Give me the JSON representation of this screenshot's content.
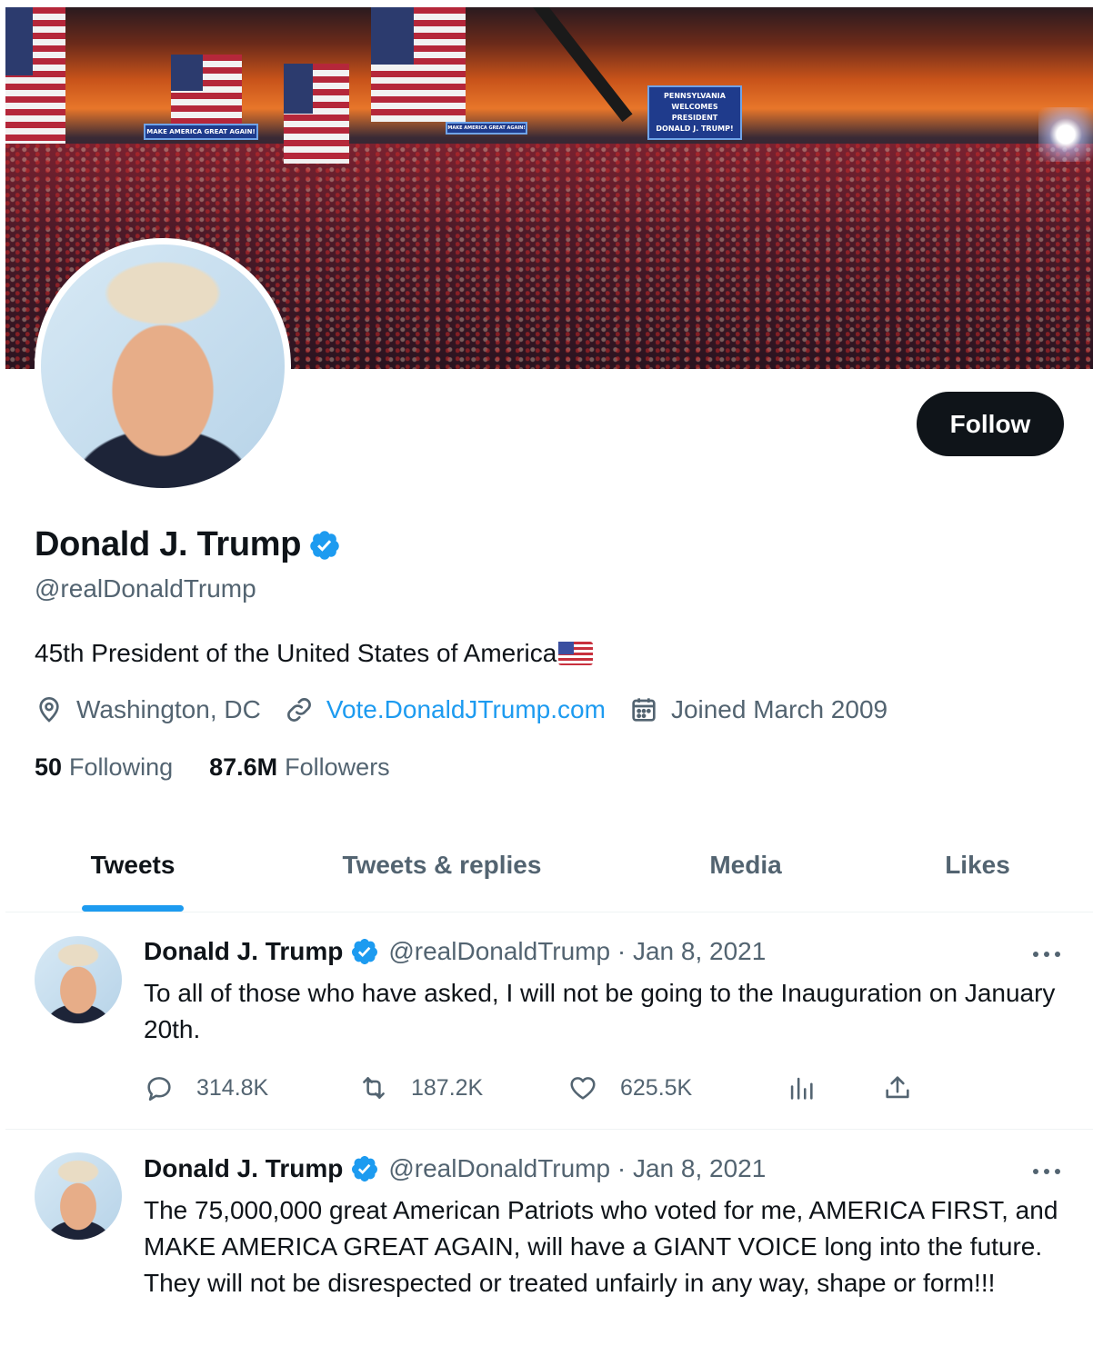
{
  "banner": {
    "signs": [
      "MAKE AMERICA GREAT AGAIN!",
      "MAKE AMERICA GREAT AGAIN!",
      "PENNSYLVANIA",
      "WELCOMES",
      "PRESIDENT",
      "DONALD J. TRUMP!"
    ]
  },
  "profile": {
    "display_name": "Donald J. Trump",
    "handle": "@realDonaldTrump",
    "bio": "45th President of the United States of America",
    "location": "Washington, DC",
    "website": "Vote.DonaldJTrump.com",
    "joined": "Joined March 2009",
    "following_count": "50",
    "following_label": "Following",
    "followers_count": "87.6M",
    "followers_label": "Followers",
    "follow_button": "Follow",
    "verified_color": "#1d9bf0"
  },
  "tabs": [
    {
      "label": "Tweets",
      "active": true
    },
    {
      "label": "Tweets & replies",
      "active": false
    },
    {
      "label": "Media",
      "active": false
    },
    {
      "label": "Likes",
      "active": false
    }
  ],
  "tweets": [
    {
      "name": "Donald J. Trump",
      "handle": "@realDonaldTrump",
      "date": "Jan 8, 2021",
      "text": "To all of those who have asked, I will not be going to the Inauguration on January 20th.",
      "replies": "314.8K",
      "retweets": "187.2K",
      "likes": "625.5K"
    },
    {
      "name": "Donald J. Trump",
      "handle": "@realDonaldTrump",
      "date": "Jan 8, 2021",
      "text": "The 75,000,000 great American Patriots who voted for me, AMERICA FIRST, and MAKE AMERICA GREAT AGAIN, will have a GIANT VOICE long into the future. They will not be disrespected or treated unfairly in any way, shape or form!!!"
    }
  ]
}
